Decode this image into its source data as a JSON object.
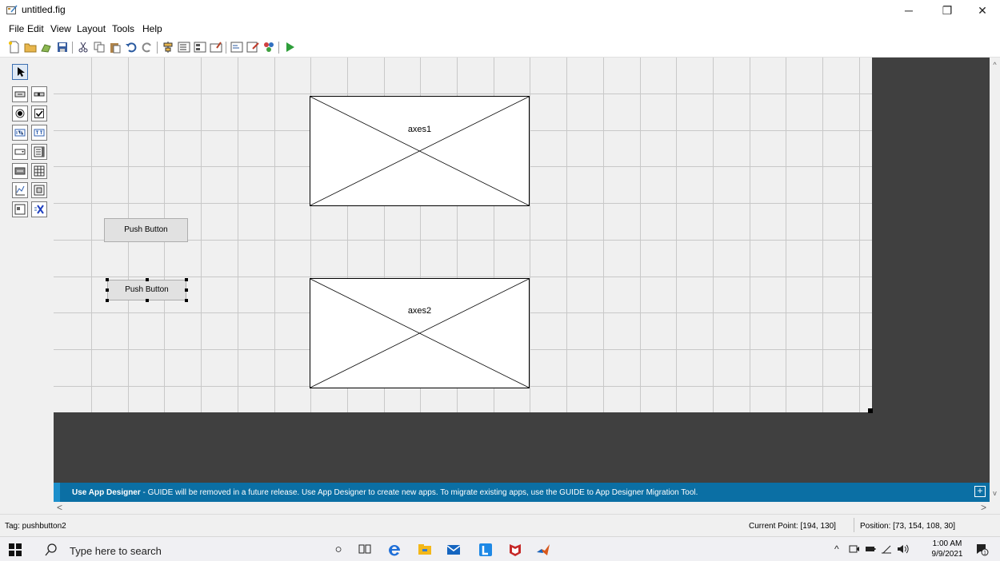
{
  "window": {
    "title": "untitled.fig",
    "controls": {
      "minimize": "─",
      "maximize": "❐",
      "close": "✕"
    }
  },
  "menu": [
    "File",
    "Edit",
    "View",
    "Layout",
    "Tools",
    "Help"
  ],
  "toolbar": {
    "icons": [
      "new-file-icon",
      "open-folder-icon",
      "open-icon",
      "save-icon",
      "cut-icon",
      "copy-icon",
      "paste-icon",
      "undo-icon",
      "redo-icon",
      "align-icon",
      "menu-editor-icon",
      "tab-order-icon",
      "toolbar-editor-icon",
      "editor-icon",
      "property-inspector-icon",
      "object-browser-icon",
      "run-figure-icon"
    ]
  },
  "palette": {
    "tools": [
      "select-tool",
      "push-button-tool",
      "slider-tool",
      "radio-button-tool",
      "checkbox-tool",
      "edit-text-tool",
      "static-text-tool",
      "popup-menu-tool",
      "listbox-tool",
      "toggle-button-tool",
      "table-tool",
      "axes-tool",
      "panel-tool",
      "button-group-tool",
      "activex-tool"
    ]
  },
  "canvas": {
    "axes": [
      {
        "label": "axes1"
      },
      {
        "label": "axes2"
      }
    ],
    "buttons": [
      {
        "label": "Push Button",
        "selected": false
      },
      {
        "label": "Push Button",
        "selected": true
      }
    ]
  },
  "banner": {
    "bold": "Use App Designer",
    "text": " - GUIDE will be removed in a future release. Use App Designer to create new apps. To migrate existing apps, use the GUIDE to App Designer Migration Tool.",
    "expand": "+"
  },
  "scroll": {
    "up": "^",
    "down": "v",
    "left": "<",
    "right": ">"
  },
  "status": {
    "tag": "Tag: pushbutton2",
    "current_point": "Current Point:  [194, 130]",
    "position": "Position: [73, 154, 108, 30]"
  },
  "taskbar": {
    "search_placeholder": "Type here to search",
    "time": "1:00 AM",
    "date": "9/9/2021",
    "notifications": "1",
    "colors": {
      "edge": "#1f6fd8",
      "explorer": "#f4b81a",
      "mail": "#1565c0",
      "l_app": "#1e88e5",
      "mcafee": "#c62828",
      "matlab": "#d9591c"
    }
  }
}
